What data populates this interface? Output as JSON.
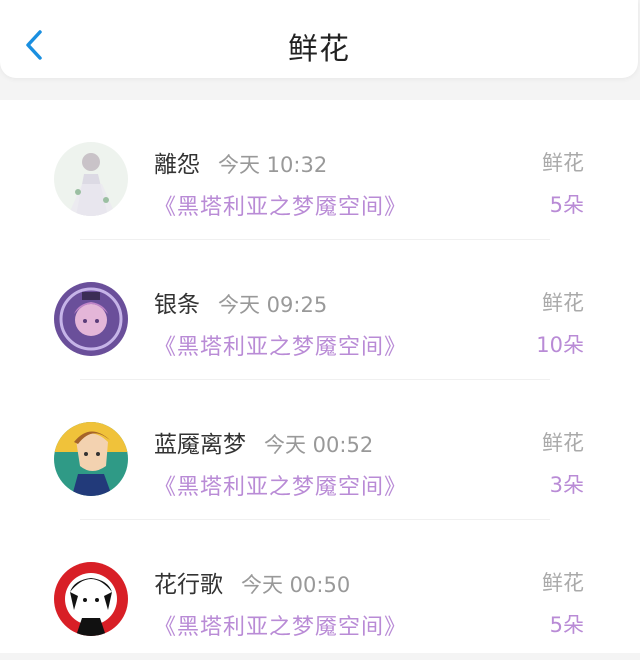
{
  "header": {
    "title": "鲜花"
  },
  "items": [
    {
      "name": "離怨",
      "time": "今天 10:32",
      "book": "《黑塔利亚之梦魇空间》",
      "gift": "鲜花",
      "count": "5朵",
      "avatar": "avatar-lace-dress"
    },
    {
      "name": "银条",
      "time": "今天 09:25",
      "book": "《黑塔利亚之梦魇空间》",
      "gift": "鲜花",
      "count": "10朵",
      "avatar": "avatar-purple-anime"
    },
    {
      "name": "蓝魇离梦",
      "time": "今天 00:52",
      "book": "《黑塔利亚之梦魇空间》",
      "gift": "鲜花",
      "count": "3朵",
      "avatar": "avatar-ginger-boy"
    },
    {
      "name": "花行歌",
      "time": "今天 00:50",
      "book": "《黑塔利亚之梦魇空间》",
      "gift": "鲜花",
      "count": "5朵",
      "avatar": "avatar-red-circle"
    }
  ],
  "colors": {
    "accent": "#1a8fe0",
    "book_text": "#b98bd6",
    "muted": "#aaaaaa"
  }
}
